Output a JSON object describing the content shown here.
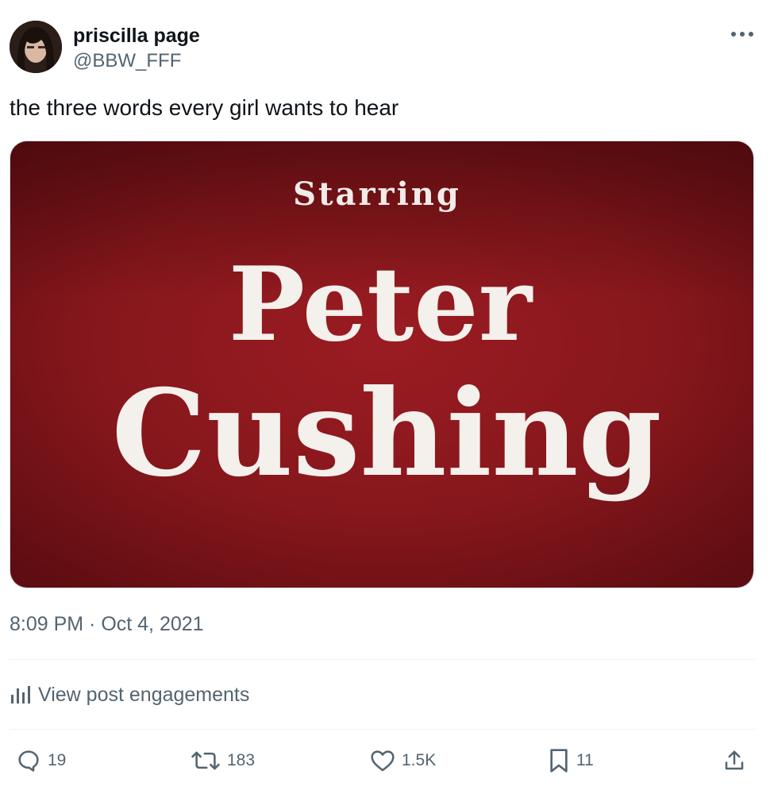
{
  "author": {
    "display_name": "priscilla page",
    "handle": "@BBW_FFF"
  },
  "post": {
    "text": "the three words every girl wants to hear",
    "timestamp": "8:09 PM · Oct 4, 2021"
  },
  "media": {
    "line1": "Starring",
    "line2": "Peter",
    "line3": "Cushing",
    "background_color": "#8a1a1f"
  },
  "engagements_label": "View post engagements",
  "actions": {
    "replies": "19",
    "reposts": "183",
    "likes": "1.5K",
    "bookmarks": "11"
  },
  "icons": {
    "more": "more-dots-icon",
    "analytics": "bar-chart-icon",
    "reply": "reply-bubble-icon",
    "repost": "repost-arrows-icon",
    "like": "heart-icon",
    "bookmark": "bookmark-icon",
    "share": "share-upload-icon"
  },
  "colors": {
    "text_primary": "#0f1419",
    "text_secondary": "#536471",
    "border": "#eff3f4"
  }
}
